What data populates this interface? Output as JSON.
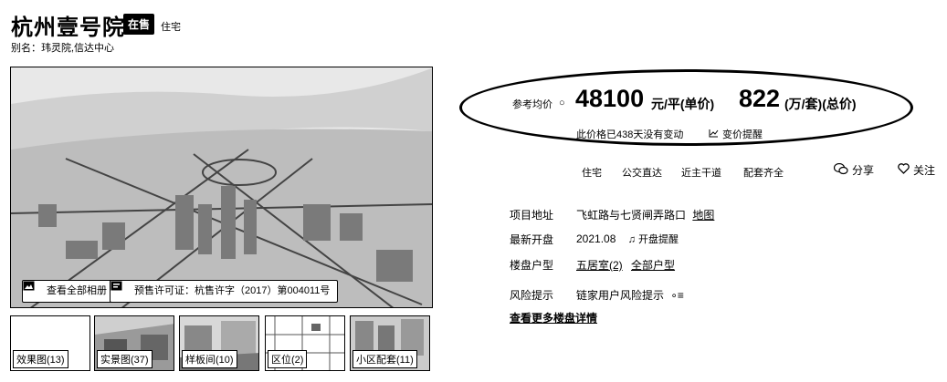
{
  "header": {
    "title": "杭州壹号院",
    "sale_badge": "在售",
    "type_tag": "住宅",
    "alias": "别名：玮灵院,信达中心"
  },
  "gallery": {
    "view_all_label": "查看全部相册",
    "license_label": "预售许可证：杭售许字（2017）第004011号",
    "thumbnails": [
      {
        "label": "效果图(13)"
      },
      {
        "label": "实景图(37)"
      },
      {
        "label": "样板间(10)"
      },
      {
        "label": "区位(2)"
      },
      {
        "label": "小区配套(11)"
      }
    ]
  },
  "price": {
    "ref_label": "参考均价",
    "unit_price": "48100",
    "unit_price_unit": "元/平(单价)",
    "total_price": "822",
    "total_price_unit": "(万/套)(总价)",
    "stale_note": "此价格已438天没有变动",
    "alert_label": "变价提醒"
  },
  "tags": [
    "住宅",
    "公交直达",
    "近主干道",
    "配套齐全"
  ],
  "actions": {
    "share_label": "分享",
    "follow_label": "关注"
  },
  "info": {
    "address_label": "项目地址",
    "address_value": "飞虹路与七贤闸弄路口",
    "map_link": "地图",
    "opening_label": "最新开盘",
    "opening_value": "2021.08",
    "opening_reminder": "开盘提醒",
    "layout_label": "楼盘户型",
    "layout_five": "五居室(2)",
    "layout_all": "全部户型",
    "risk_label": "风险提示",
    "risk_value": "链家用户风险提示",
    "more_link": "查看更多楼盘详情"
  },
  "icons": {
    "info": "info-icon",
    "chart": "chart-icon",
    "share": "wechat-icon",
    "follow": "heart-icon",
    "bell": "bell-icon",
    "photo": "photo-icon",
    "license": "license-icon"
  }
}
